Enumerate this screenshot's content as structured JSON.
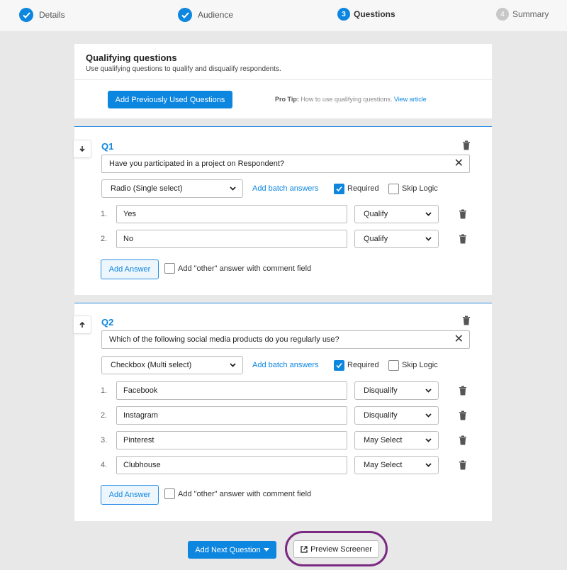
{
  "stepper": {
    "steps": [
      {
        "label": "Details",
        "state": "done"
      },
      {
        "label": "Audience",
        "state": "done"
      },
      {
        "label": "Questions",
        "number": "3",
        "state": "active"
      },
      {
        "label": "Summary",
        "number": "4",
        "state": "pending"
      }
    ]
  },
  "intro": {
    "title": "Qualifying questions",
    "subtitle": "Use qualifying questions to qualify and disqualify respondents.",
    "add_previous_label": "Add Previously Used Questions",
    "tip_bold": "Pro Tip:",
    "tip_text": " How to use qualifying questions. ",
    "tip_link": "View article"
  },
  "questions": [
    {
      "label": "Q1",
      "text": "Have you participated in a project on Respondent?",
      "type": "Radio (Single select)",
      "batch_label": "Add batch answers",
      "required_label": "Required",
      "required": true,
      "skip_logic_label": "Skip Logic",
      "skip_logic": false,
      "answers": [
        {
          "num": "1.",
          "text": "Yes",
          "action": "Qualify"
        },
        {
          "num": "2.",
          "text": "No",
          "action": "Qualify"
        }
      ],
      "add_answer_label": "Add Answer",
      "other_label": "Add \"other\" answer with comment field"
    },
    {
      "label": "Q2",
      "text": "Which of the following social media products do you regularly use?",
      "type": "Checkbox (Multi select)",
      "batch_label": "Add batch answers",
      "required_label": "Required",
      "required": true,
      "skip_logic_label": "Skip Logic",
      "skip_logic": false,
      "answers": [
        {
          "num": "1.",
          "text": "Facebook",
          "action": "Disqualify"
        },
        {
          "num": "2.",
          "text": "Instagram",
          "action": "Disqualify"
        },
        {
          "num": "3.",
          "text": "Pinterest",
          "action": "May Select"
        },
        {
          "num": "4.",
          "text": "Clubhouse",
          "action": "May Select"
        }
      ],
      "add_answer_label": "Add Answer",
      "other_label": "Add \"other\" answer with comment field"
    }
  ],
  "footer": {
    "add_next_label": "Add Next Question",
    "preview_label": "Preview Screener"
  },
  "colors": {
    "accent": "#0d86e0",
    "highlight_ring": "#7a2a82"
  }
}
